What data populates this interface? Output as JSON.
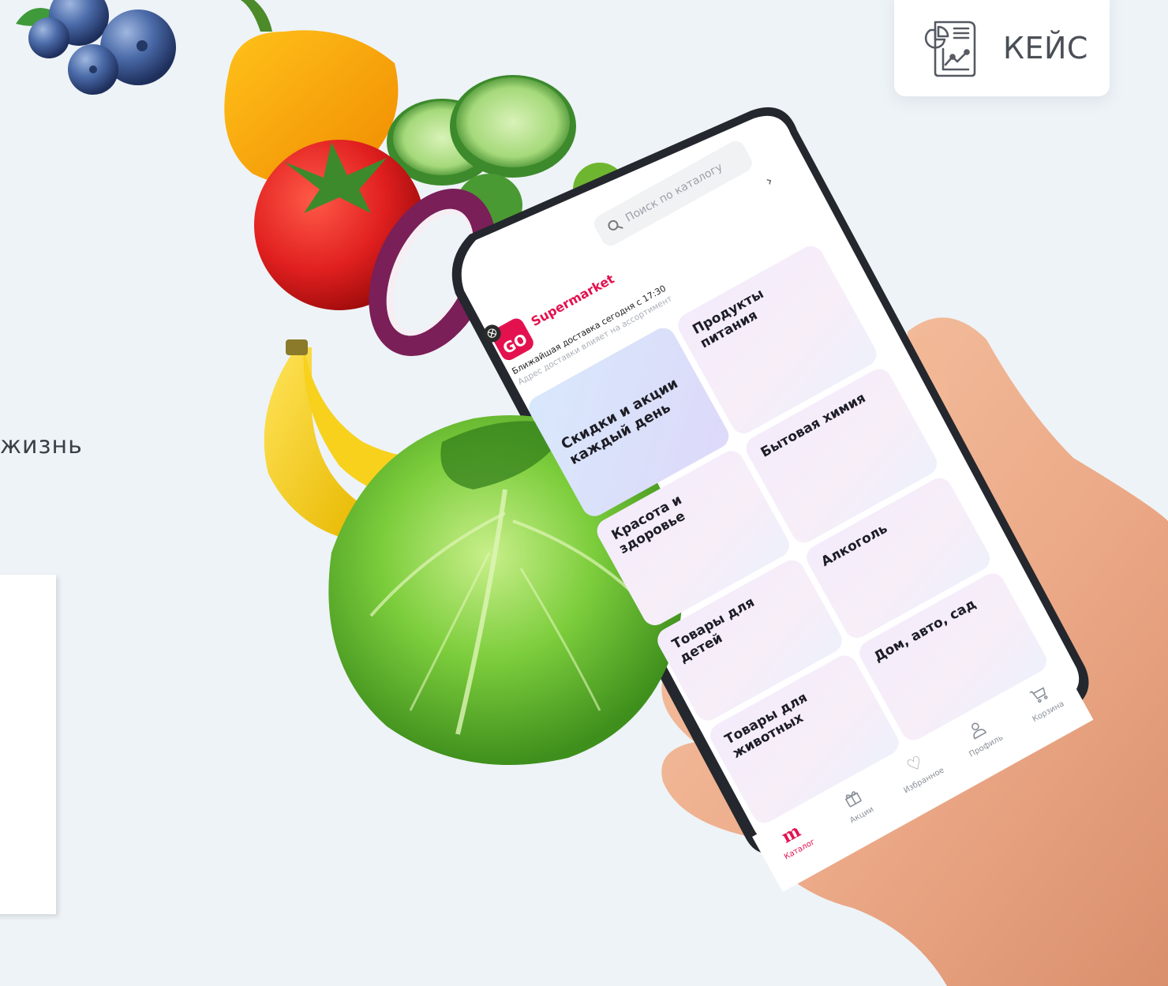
{
  "case_badge": {
    "label": "КЕЙС",
    "icon": "report-chart-icon"
  },
  "left_text": "жизнь",
  "app": {
    "search_placeholder": "Поиск по каталогу",
    "logo_text": "GO",
    "brand": "Supermarket",
    "delivery_text": "Ближайшая доставка сегодня с 17:30",
    "delivery_sub": "Адрес доставки влияет на ассортимент",
    "promo_tile": "Скидки и акции каждый день",
    "categories": [
      "Продукты питания",
      "Бытовая химия",
      "Красота и здоровье",
      "Алкоголь",
      "Товары для детей",
      "Дом, авто, сад",
      "Товары для животных"
    ],
    "tabs": [
      {
        "label": "Каталог",
        "icon": "m-logo-icon",
        "active": true
      },
      {
        "label": "Акции",
        "icon": "gift-icon"
      },
      {
        "label": "Избранное",
        "icon": "heart-icon"
      },
      {
        "label": "Профиль",
        "icon": "profile-icon"
      },
      {
        "label": "Корзина",
        "icon": "cart-icon"
      }
    ]
  },
  "colors": {
    "brand": "#e3124f",
    "background": "#eef3f7"
  }
}
